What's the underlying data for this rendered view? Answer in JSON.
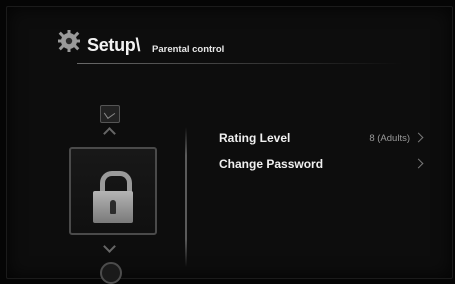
{
  "header": {
    "title": "Setup\\",
    "subtitle": "Parental control",
    "icon": "gear-icon"
  },
  "nav": {
    "top_icon": "picture-icon",
    "selected_icon": "lock-icon",
    "bottom_icon": "disc-icon"
  },
  "menu": {
    "items": [
      {
        "label": "Rating Level",
        "value": "8 (Adults)"
      },
      {
        "label": "Change Password",
        "value": ""
      }
    ]
  }
}
